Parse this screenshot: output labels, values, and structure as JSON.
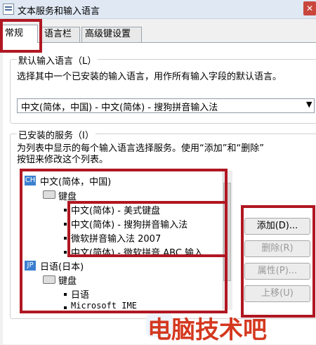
{
  "window": {
    "title": "文本服务和输入语言",
    "close_glyph": "✕"
  },
  "tabs": [
    {
      "label": "常规"
    },
    {
      "label": "语言栏"
    },
    {
      "label": "高级键设置"
    }
  ],
  "default_language": {
    "heading": "默认输入语言（L）",
    "description": "选择其中一个已安装的输入语言，用作所有输入字段的默认语言。",
    "selected": "中文(简体，中国) - 中文(简体) - 搜狗拼音输入法"
  },
  "installed": {
    "heading": "已安装的服务（I）",
    "description_line1": "为列表中显示的每个输入语言选择服务。使用“添加”和“删除”",
    "description_line2": "按钮来修改这个列表。",
    "tree": {
      "lang1": {
        "badge": "CH",
        "name": "中文(简体，中国)"
      },
      "kbd1": "键盘",
      "lang1_items": [
        "中文(简体) - 美式键盘",
        "中文(简体) - 搜狗拼音输入法",
        "微软拼音输入法 2007",
        "中文(简体) - 微软拼音 ABC 输入"
      ],
      "lang2": {
        "badge": "JP",
        "name": "日语(日本)"
      },
      "kbd2": "键盘",
      "lang2_items": [
        "日语",
        "Microsoft IME"
      ]
    }
  },
  "buttons": {
    "add": "添加(D)...",
    "remove": "删除(R)",
    "properties": "属性(P)...",
    "move_up": "上移(U)"
  },
  "watermark": "电脑技术吧",
  "colors": {
    "annotation": "#b01722",
    "watermark": "#d4381f"
  }
}
